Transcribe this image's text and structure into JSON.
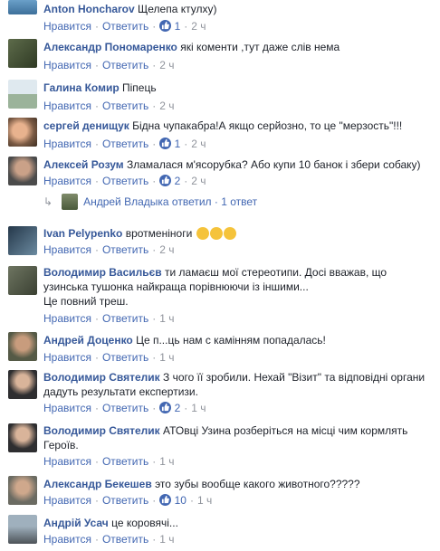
{
  "actions": {
    "like": "Нравится",
    "reply": "Ответить",
    "sep": "·"
  },
  "comments": [
    {
      "author": "Anton Honcharov",
      "text": "Щелепа ктулху)",
      "likes": "1",
      "time": "2 ч"
    },
    {
      "author": "Александр Пономаренко",
      "text": "які коменти ,тут даже слів нема",
      "likes": "",
      "time": "2 ч"
    },
    {
      "author": "Галина Комир",
      "text": "Піпець",
      "likes": "",
      "time": "2 ч"
    },
    {
      "author": "сергей денищук",
      "text": "Бідна чупакабра!А якщо серйозно, то це \"мерзость\"!!!",
      "likes": "1",
      "time": "2 ч"
    },
    {
      "author": "Алексей Розум",
      "text": "Зламалася м'ясорубка? Або купи 10 банок і збери собаку)",
      "likes": "2",
      "time": "2 ч"
    },
    {
      "author": "Ivan Pelypenko",
      "text": "вротменіноги",
      "likes": "",
      "time": "2 ч"
    },
    {
      "author": "Володимир Васильєв",
      "text": "ти ламаєш мої стереотипи. Досі вважав, що узинська тушонка найкраща порівнюючи із іншими...",
      "text2": "Це повний треш.",
      "likes": "",
      "time": "1 ч"
    },
    {
      "author": "Андрей Доценко",
      "text": "Це п...ць нам с камінням попадалась!",
      "likes": "",
      "time": "1 ч"
    },
    {
      "author": "Володимир Святелик",
      "text": "З чого її зробили. Нехай \"Візит\" та відповідні органи дадуть результати експертизи.",
      "likes": "2",
      "time": "1 ч"
    },
    {
      "author": "Володимир Святелик",
      "text": "АТОвці Узина розберіться на місці чим кормлять Героїв.",
      "likes": "",
      "time": "1 ч"
    },
    {
      "author": "Александр Бекешев",
      "text": "это зубы вообще какого животного?????",
      "likes": "10",
      "time": "1 ч"
    },
    {
      "author": "Андрій Усач",
      "text": "це коровячі...",
      "likes": "",
      "time": "1 ч"
    }
  ],
  "reply_thread": {
    "name": "Андрей Владыка",
    "text": "ответил · 1 ответ"
  },
  "colors": {
    "link": "#4267b2",
    "author": "#365899",
    "meta": "#90949c"
  }
}
